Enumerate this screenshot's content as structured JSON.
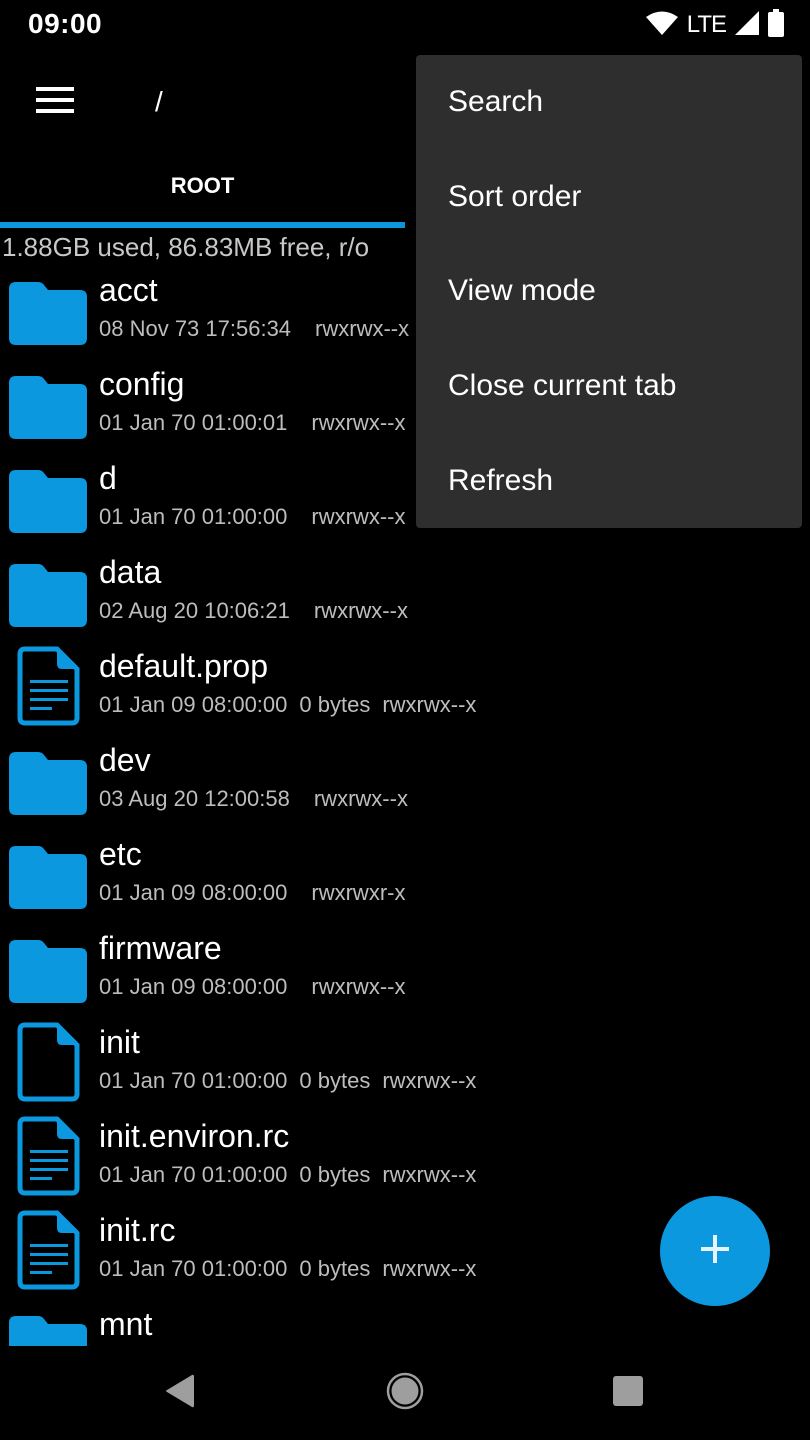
{
  "status_bar": {
    "time": "09:00",
    "network_label": "LTE",
    "icons": [
      "wifi-icon",
      "cellular-signal-icon",
      "battery-icon"
    ]
  },
  "toolbar": {
    "menu_icon": "hamburger-menu-icon",
    "path": "/"
  },
  "tabs": [
    {
      "label": "ROOT",
      "active": true
    }
  ],
  "storage_info": "1.88GB used, 86.83MB free, r/o",
  "colors": {
    "accent": "#0b98de",
    "background": "#000000",
    "menu_background": "#2e2e2e",
    "secondary_text": "#bdbdbd"
  },
  "files": [
    {
      "name": "acct",
      "type": "folder",
      "date": "08 Nov 73 17:56:34",
      "size": "",
      "permissions": "rwxrwx--x"
    },
    {
      "name": "config",
      "type": "folder",
      "date": "01 Jan 70 01:00:01",
      "size": "",
      "permissions": "rwxrwx--x"
    },
    {
      "name": "d",
      "type": "folder",
      "date": "01 Jan 70 01:00:00",
      "size": "",
      "permissions": "rwxrwx--x"
    },
    {
      "name": "data",
      "type": "folder",
      "date": "02 Aug 20 10:06:21",
      "size": "",
      "permissions": "rwxrwx--x"
    },
    {
      "name": "default.prop",
      "type": "text-file",
      "date": "01 Jan 09 08:00:00",
      "size": "0 bytes",
      "permissions": "rwxrwx--x"
    },
    {
      "name": "dev",
      "type": "folder",
      "date": "03 Aug 20 12:00:58",
      "size": "",
      "permissions": "rwxrwx--x"
    },
    {
      "name": "etc",
      "type": "folder",
      "date": "01 Jan 09 08:00:00",
      "size": "",
      "permissions": "rwxrwxr-x"
    },
    {
      "name": "firmware",
      "type": "folder",
      "date": "01 Jan 09 08:00:00",
      "size": "",
      "permissions": "rwxrwx--x"
    },
    {
      "name": "init",
      "type": "file",
      "date": "01 Jan 70 01:00:00",
      "size": "0 bytes",
      "permissions": "rwxrwx--x"
    },
    {
      "name": "init.environ.rc",
      "type": "text-file",
      "date": "01 Jan 70 01:00:00",
      "size": "0 bytes",
      "permissions": "rwxrwx--x"
    },
    {
      "name": "init.rc",
      "type": "text-file",
      "date": "01 Jan 70 01:00:00",
      "size": "0 bytes",
      "permissions": "rwxrwx--x"
    },
    {
      "name": "mnt",
      "type": "folder",
      "date": "",
      "size": "",
      "permissions": ""
    }
  ],
  "overflow_menu": {
    "items": [
      {
        "label": "Search"
      },
      {
        "label": "Sort order"
      },
      {
        "label": "View mode"
      },
      {
        "label": "Close current tab"
      },
      {
        "label": "Refresh"
      }
    ]
  },
  "fab": {
    "icon": "plus-icon"
  },
  "nav_bar": {
    "buttons": [
      "back-icon",
      "home-icon",
      "recents-icon"
    ]
  }
}
